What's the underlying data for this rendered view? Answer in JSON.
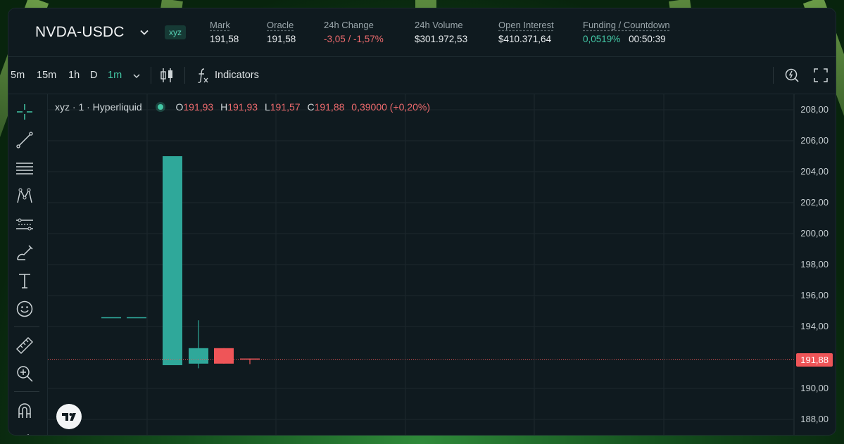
{
  "header": {
    "pair": "NVDA-USDC",
    "badge": "xyz",
    "stats": [
      {
        "label": "Mark",
        "value": "191,58",
        "tone": ""
      },
      {
        "label": "Oracle",
        "value": "191,58",
        "tone": ""
      },
      {
        "label": "24h Change",
        "value": "-3,05 / -1,57%",
        "tone": "neg"
      },
      {
        "label": "24h Volume",
        "value": "$301.972,53",
        "tone": ""
      },
      {
        "label": "Open Interest",
        "value": "$410.371,64",
        "tone": ""
      },
      {
        "label": "Funding / Countdown",
        "value": "0,0519%",
        "value2": "00:50:39",
        "tone": "pos"
      }
    ]
  },
  "toolbar": {
    "timeframes": [
      "5m",
      "15m",
      "1h",
      "D",
      "1m"
    ],
    "active_timeframe": "1m",
    "indicators_label": "Indicators"
  },
  "legend": {
    "symbol": "xyz · 1 · Hyperliquid",
    "open_key": "O",
    "open": "191,93",
    "high_key": "H",
    "high": "191,93",
    "low_key": "L",
    "low": "191,57",
    "close_key": "C",
    "close": "191,88",
    "change": "0,39000 (+0,20%)"
  },
  "chart_data": {
    "type": "candlestick",
    "ylim": [
      187,
      209
    ],
    "y_ticks": [
      "208,00",
      "206,00",
      "204,00",
      "202,00",
      "200,00",
      "198,00",
      "196,00",
      "194,00",
      "191,88",
      "190,00",
      "188,00"
    ],
    "current_price": 191.88,
    "current_price_label": "191,88",
    "candles": [
      {
        "open": 194.6,
        "high": 194.6,
        "low": 194.6,
        "close": 194.6
      },
      {
        "open": 194.6,
        "high": 194.6,
        "low": 194.6,
        "close": 194.6
      },
      {
        "open": 191.5,
        "high": 205.0,
        "low": 191.5,
        "close": 205.0
      },
      {
        "open": 191.6,
        "high": 194.4,
        "low": 191.3,
        "close": 192.6
      },
      {
        "open": 192.6,
        "high": 192.6,
        "low": 191.6,
        "close": 191.6
      },
      {
        "open": 191.93,
        "high": 191.93,
        "low": 191.57,
        "close": 191.88
      }
    ],
    "up_color": "#2fa89a",
    "down_color": "#ef5558"
  },
  "colors": {
    "accent": "#43c7a5",
    "negative": "#ed6a6d",
    "panel": "#0f1a1f"
  }
}
